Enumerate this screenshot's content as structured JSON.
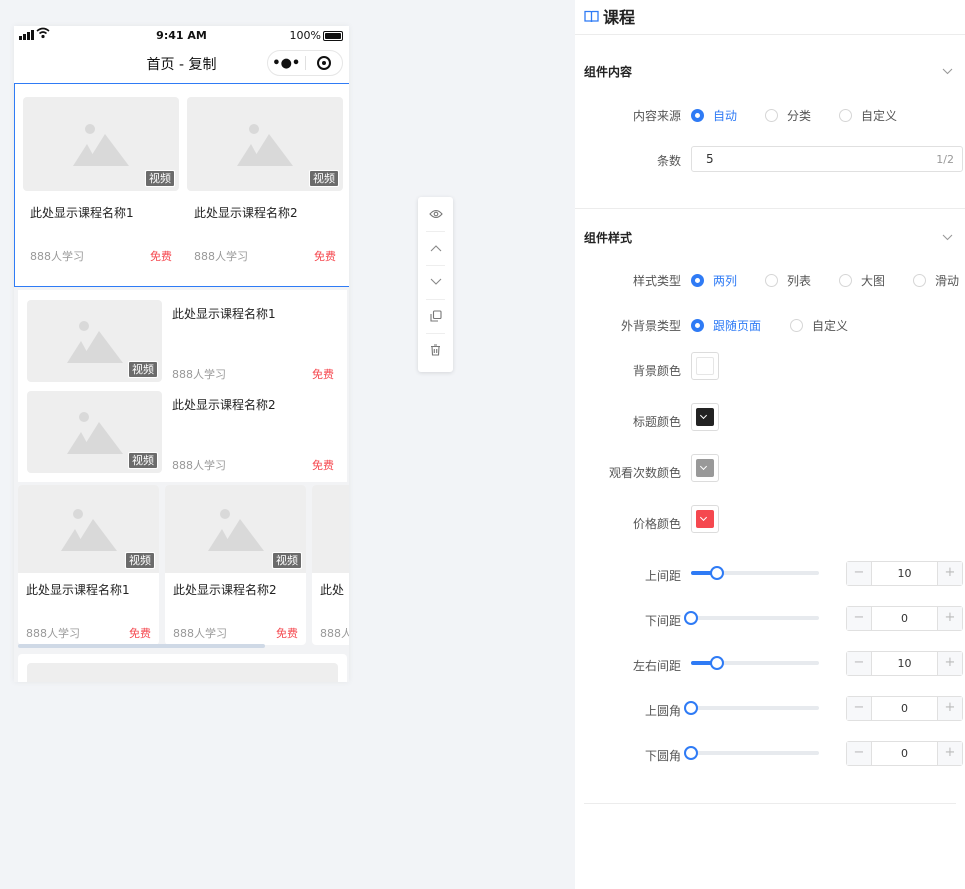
{
  "statusbar": {
    "time": "9:41 AM",
    "battery": "100%"
  },
  "navbar": {
    "title": "首页 - 复制"
  },
  "course_name_1": "此处显示课程名称1",
  "course_name_2": "此处显示课程名称2",
  "course_name_clip": "此处",
  "video_badge": "视频",
  "learners": "888人学习",
  "learners_clip": "888人",
  "price_free": "免费",
  "panel": {
    "title": "课程",
    "group_content": "组件内容",
    "content_source": {
      "label": "内容来源",
      "options": [
        "自动",
        "分类",
        "自定义"
      ],
      "selected": "自动"
    },
    "count": {
      "label": "条数",
      "value": "5",
      "counter": "1/2"
    },
    "group_style": "组件样式",
    "style_type": {
      "label": "样式类型",
      "options": [
        "两列",
        "列表",
        "大图",
        "滑动"
      ],
      "selected": "两列"
    },
    "bg_type": {
      "label": "外背景类型",
      "options": [
        "跟随页面",
        "自定义"
      ],
      "selected": "跟随页面"
    },
    "colors": {
      "bg": {
        "label": "背景颜色",
        "value": "#ffffff"
      },
      "title": {
        "label": "标题颜色",
        "value": "#222222"
      },
      "views": {
        "label": "观看次数颜色",
        "value": "#999999"
      },
      "price": {
        "label": "价格颜色",
        "value": "#f5484f"
      }
    },
    "sliders": [
      {
        "label": "上间距",
        "value": "10",
        "level": 0.2
      },
      {
        "label": "下间距",
        "value": "0",
        "level": 0
      },
      {
        "label": "左右间距",
        "value": "10",
        "level": 0.2
      },
      {
        "label": "上圆角",
        "value": "0",
        "level": 0
      },
      {
        "label": "下圆角",
        "value": "0",
        "level": 0
      }
    ],
    "minus": "−",
    "plus": "+"
  },
  "accent_color": "#2f7bf5"
}
